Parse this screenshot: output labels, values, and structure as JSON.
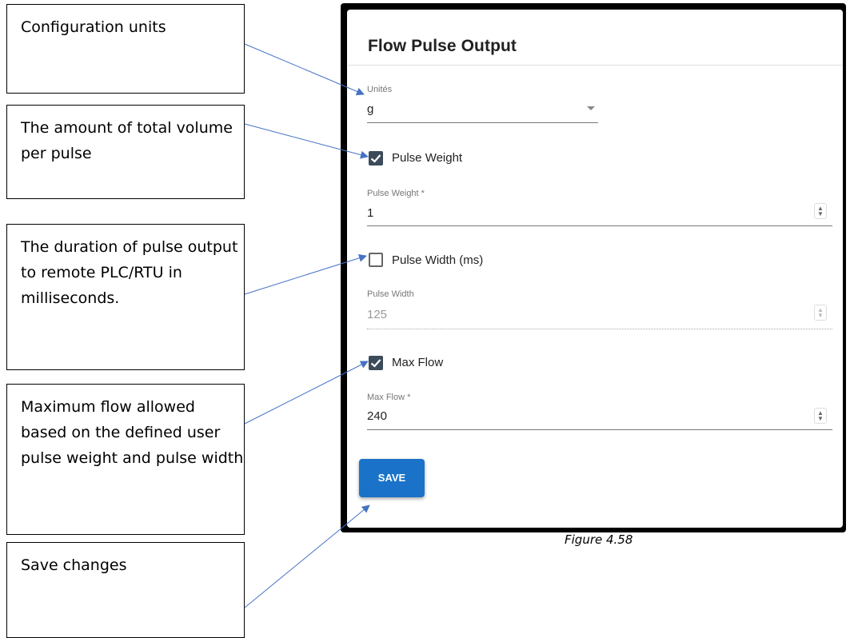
{
  "callouts": [
    {
      "text": "Configuration units"
    },
    {
      "text": "The amount of total volume per pulse"
    },
    {
      "text": "The duration of pulse output to remote PLC/RTU in milliseconds."
    },
    {
      "text": "Maximum flow allowed based on the defined user pulse weight and pulse width"
    },
    {
      "text": "Save changes"
    }
  ],
  "panel": {
    "title": "Flow Pulse Output",
    "units": {
      "label": "Unités",
      "value": "g"
    },
    "pulse_weight_checkbox": {
      "label": "Pulse Weight",
      "checked": true
    },
    "pulse_weight_field": {
      "label": "Pulse Weight *",
      "value": "1"
    },
    "pulse_width_checkbox": {
      "label": "Pulse Width (ms)",
      "checked": false
    },
    "pulse_width_field": {
      "label": "Pulse Width",
      "value": "125"
    },
    "max_flow_checkbox": {
      "label": "Max Flow",
      "checked": true
    },
    "max_flow_field": {
      "label": "Max Flow *",
      "value": "240"
    },
    "save_label": "SAVE"
  },
  "caption": "Figure 4.58",
  "colors": {
    "arrow": "#4472c4",
    "primary": "#1a73c8",
    "checkbox": "#3c4b5a"
  }
}
